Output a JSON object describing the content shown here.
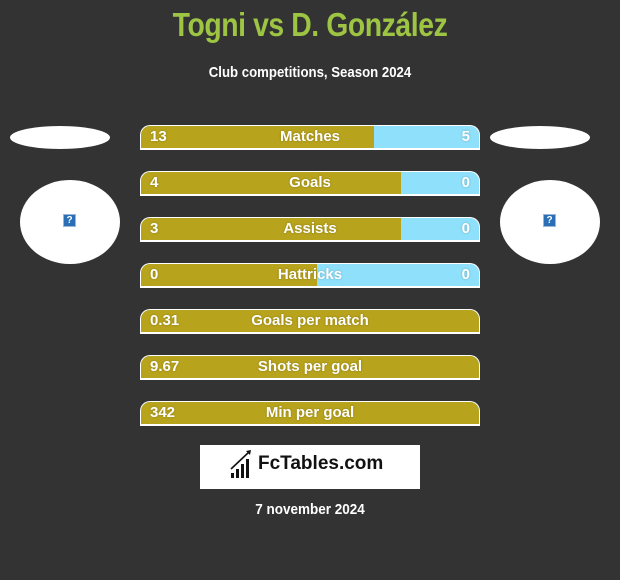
{
  "header": {
    "title": "Togni vs D. González",
    "subtitle": "Club competitions, Season 2024"
  },
  "players": {
    "left": {
      "image_icon": "broken-image-icon",
      "image_glyph": "?"
    },
    "right": {
      "image_icon": "broken-image-icon",
      "image_glyph": "?"
    }
  },
  "colors": {
    "title": "#9dc443",
    "left_bar": "#b8a31c",
    "right_bar": "#8fe0fb",
    "background": "#333333"
  },
  "stats": [
    {
      "label": "Matches",
      "left": "13",
      "right": "5",
      "left_share": 0.69
    },
    {
      "label": "Goals",
      "left": "4",
      "right": "0",
      "left_share": 0.77
    },
    {
      "label": "Assists",
      "left": "3",
      "right": "0",
      "left_share": 0.77
    },
    {
      "label": "Hattricks",
      "left": "0",
      "right": "0",
      "left_share": 0.52
    },
    {
      "label": "Goals per match",
      "left": "0.31",
      "right": "",
      "left_share": 1
    },
    {
      "label": "Shots per goal",
      "left": "9.67",
      "right": "",
      "left_share": 1
    },
    {
      "label": "Min per goal",
      "left": "342",
      "right": "",
      "left_share": 1
    }
  ],
  "footer": {
    "logo_text": "FcTables.com",
    "logo_icon": "bar-chart-icon",
    "date": "7 november 2024"
  }
}
